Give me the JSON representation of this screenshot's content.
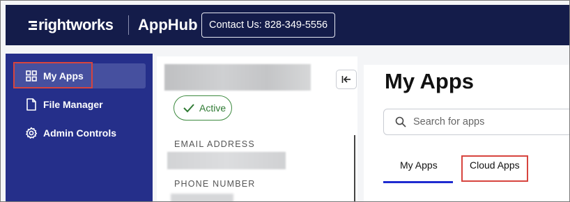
{
  "header": {
    "brand": "rightworks",
    "product": "AppHub",
    "contact_label": "Contact Us: 828-349-5556"
  },
  "sidebar": {
    "items": [
      {
        "label": "My Apps",
        "icon": "grid-icon",
        "active": true
      },
      {
        "label": "File Manager",
        "icon": "file-icon",
        "active": false
      },
      {
        "label": "Admin Controls",
        "icon": "gear-icon",
        "active": false
      }
    ]
  },
  "profile": {
    "status": "Active",
    "email_label": "EMAIL ADDRESS",
    "phone_label": "PHONE NUMBER"
  },
  "main": {
    "title": "My Apps",
    "search_placeholder": "Search for apps",
    "tabs": [
      {
        "label": "My Apps",
        "selected": true
      },
      {
        "label": "Cloud Apps",
        "selected": false
      }
    ]
  },
  "colors": {
    "header_bg": "#141c4a",
    "sidebar_bg": "#252f8a",
    "active_item_bg": "#46509f",
    "status_green": "#2f7a33",
    "highlight_red": "#d7443e",
    "tab_underline": "#1f2bd0"
  }
}
